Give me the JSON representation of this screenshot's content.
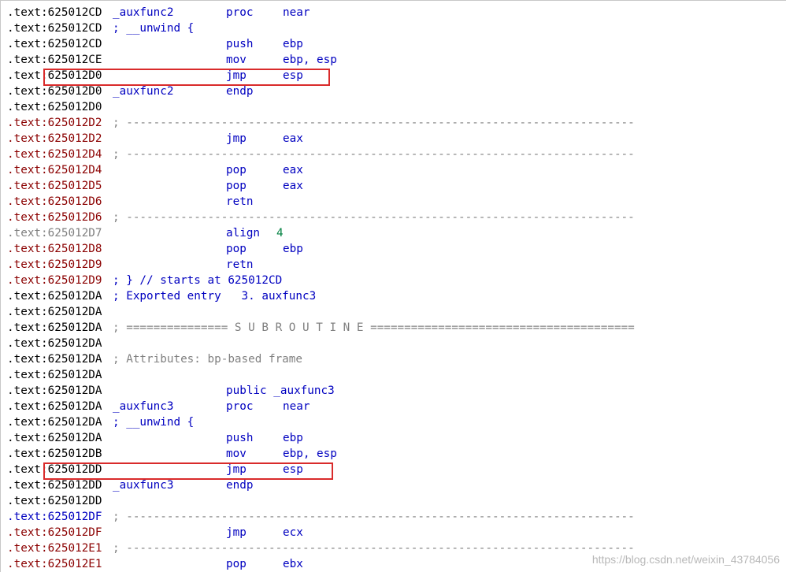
{
  "listing": [
    {
      "seg": ".text:",
      "addr": "625012CD",
      "color": "blk",
      "label": "_auxfunc2",
      "op": "proc",
      "arg": "near",
      "op_color": "blue",
      "arg_color": "blue"
    },
    {
      "seg": ".text:",
      "addr": "625012CD",
      "color": "blk",
      "comment": "; __unwind {",
      "comment_color": "blue"
    },
    {
      "seg": ".text:",
      "addr": "625012CD",
      "color": "blk",
      "op": "push",
      "arg": "ebp",
      "op_color": "blue",
      "arg_color": "blue"
    },
    {
      "seg": ".text:",
      "addr": "625012CE",
      "color": "blk",
      "op": "mov",
      "arg": "ebp, esp",
      "op_color": "blue",
      "arg_color": "blue"
    },
    {
      "seg": ".text:",
      "addr": "625012D0",
      "color": "blk",
      "op": "jmp",
      "arg": "esp",
      "op_color": "blue",
      "arg_color": "blue"
    },
    {
      "seg": ".text:",
      "addr": "625012D0",
      "color": "blk",
      "label": "_auxfunc2",
      "op": "endp",
      "op_color": "blue"
    },
    {
      "seg": ".text:",
      "addr": "625012D0",
      "color": "blk"
    },
    {
      "seg": ".text:",
      "addr": "625012D2",
      "color": "red",
      "comment": "; ---------------------------------------------------------------------------",
      "comment_color": "gray"
    },
    {
      "seg": ".text:",
      "addr": "625012D2",
      "color": "red",
      "op": "jmp",
      "arg": "eax",
      "op_color": "blue",
      "arg_color": "blue"
    },
    {
      "seg": ".text:",
      "addr": "625012D4",
      "color": "red",
      "comment": "; ---------------------------------------------------------------------------",
      "comment_color": "gray"
    },
    {
      "seg": ".text:",
      "addr": "625012D4",
      "color": "red",
      "op": "pop",
      "arg": "eax",
      "op_color": "blue",
      "arg_color": "blue"
    },
    {
      "seg": ".text:",
      "addr": "625012D5",
      "color": "red",
      "op": "pop",
      "arg": "eax",
      "op_color": "blue",
      "arg_color": "blue"
    },
    {
      "seg": ".text:",
      "addr": "625012D6",
      "color": "red",
      "op": "retn",
      "op_color": "blue"
    },
    {
      "seg": ".text:",
      "addr": "625012D6",
      "color": "red",
      "comment": "; ---------------------------------------------------------------------------",
      "comment_color": "gray"
    },
    {
      "seg": ".text:",
      "addr": "625012D7",
      "color": "gray",
      "op": "align",
      "arg": "4",
      "op_color": "blue",
      "arg_color": "green",
      "arg_left": "342"
    },
    {
      "seg": ".text:",
      "addr": "625012D8",
      "color": "red",
      "op": "pop",
      "arg": "ebp",
      "op_color": "blue",
      "arg_color": "blue"
    },
    {
      "seg": ".text:",
      "addr": "625012D9",
      "color": "red",
      "op": "retn",
      "op_color": "blue"
    },
    {
      "seg": ".text:",
      "addr": "625012D9",
      "color": "red",
      "comment": "; } // starts at 625012CD",
      "comment_color": "blue"
    },
    {
      "seg": ".text:",
      "addr": "625012DA",
      "color": "blk",
      "comment": "; Exported entry   3. auxfunc3",
      "comment_color": "blue"
    },
    {
      "seg": ".text:",
      "addr": "625012DA",
      "color": "blk"
    },
    {
      "seg": ".text:",
      "addr": "625012DA",
      "color": "blk",
      "comment": "; =============== S U B R O U T I N E =======================================",
      "comment_color": "gray"
    },
    {
      "seg": ".text:",
      "addr": "625012DA",
      "color": "blk"
    },
    {
      "seg": ".text:",
      "addr": "625012DA",
      "color": "blk",
      "comment": "; Attributes: bp-based frame",
      "comment_color": "gray"
    },
    {
      "seg": ".text:",
      "addr": "625012DA",
      "color": "blk"
    },
    {
      "seg": ".text:",
      "addr": "625012DA",
      "color": "blk",
      "op": "public _auxfunc3",
      "op_color": "blue"
    },
    {
      "seg": ".text:",
      "addr": "625012DA",
      "color": "blk",
      "label": "_auxfunc3",
      "op": "proc",
      "arg": "near",
      "op_color": "blue",
      "arg_color": "blue"
    },
    {
      "seg": ".text:",
      "addr": "625012DA",
      "color": "blk",
      "comment": "; __unwind {",
      "comment_color": "blue"
    },
    {
      "seg": ".text:",
      "addr": "625012DA",
      "color": "blk",
      "op": "push",
      "arg": "ebp",
      "op_color": "blue",
      "arg_color": "blue"
    },
    {
      "seg": ".text:",
      "addr": "625012DB",
      "color": "blk",
      "op": "mov",
      "arg": "ebp, esp",
      "op_color": "blue",
      "arg_color": "blue"
    },
    {
      "seg": ".text:",
      "addr": "625012DD",
      "color": "blk",
      "op": "jmp",
      "arg": "esp",
      "op_color": "blue",
      "arg_color": "blue"
    },
    {
      "seg": ".text:",
      "addr": "625012DD",
      "color": "blk",
      "label": "_auxfunc3",
      "op": "endp",
      "op_color": "blue"
    },
    {
      "seg": ".text:",
      "addr": "625012DD",
      "color": "blk"
    },
    {
      "seg": ".text:",
      "addr": "625012DF",
      "color": "blue",
      "comment": "; ---------------------------------------------------------------------------",
      "comment_color": "gray"
    },
    {
      "seg": ".text:",
      "addr": "625012DF",
      "color": "red",
      "op": "jmp",
      "arg": "ecx",
      "op_color": "blue",
      "arg_color": "blue"
    },
    {
      "seg": ".text:",
      "addr": "625012E1",
      "color": "red",
      "comment": "; ---------------------------------------------------------------------------",
      "comment_color": "gray"
    },
    {
      "seg": ".text:",
      "addr": "625012E1",
      "color": "red",
      "op": "pop",
      "arg": "ebx",
      "op_color": "blue",
      "arg_color": "blue"
    }
  ],
  "watermark": "https://blog.csdn.net/weixin_43784056",
  "colors": {
    "highlight_box": "#d92b2b",
    "blue_text": "#0000c0",
    "red_address": "#8b0000"
  }
}
